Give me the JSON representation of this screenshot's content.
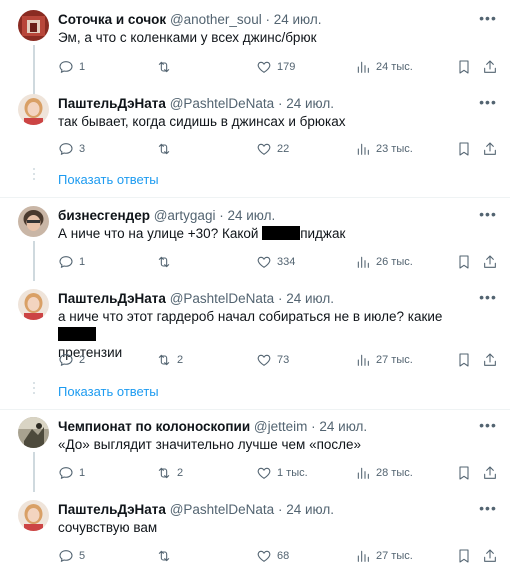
{
  "tweets": [
    {
      "name": "Соточка и сочок",
      "handle": "@another_soul",
      "date": "24 июл.",
      "text": "Эм, а что с коленками у всех джинс/брюк",
      "replies": "1",
      "retweets": "",
      "likes": "179",
      "views": "24 тыс."
    },
    {
      "name": "ПаштельДэНата",
      "handle": "@PashtelDeNata",
      "date": "24 июл.",
      "text": "так бывает, когда сидишь в джинсах и брюках",
      "replies": "3",
      "retweets": "",
      "likes": "22",
      "views": "23 тыс."
    },
    {
      "name": "бизнесгендер",
      "handle": "@artygagi",
      "date": "24 июл.",
      "text_a": "А ниче что на улице +30? Какой",
      "text_b": "пиджак",
      "replies": "1",
      "retweets": "",
      "likes": "334",
      "views": "26 тыс."
    },
    {
      "name": "ПаштельДэНата",
      "handle": "@PashtelDeNata",
      "date": "24 июл.",
      "text_a": "а ниче что этот гардероб начал собираться не в июле? какие",
      "text_b": "претензии",
      "replies": "2",
      "retweets": "2",
      "likes": "73",
      "views": "27 тыс."
    },
    {
      "name": "Чемпионат по колоноскопии",
      "handle": "@jetteim",
      "date": "24 июл.",
      "text": "«До» выглядит значительно лучше чем «после»",
      "replies": "1",
      "retweets": "2",
      "likes": "1 тыс.",
      "views": "28 тыс."
    },
    {
      "name": "ПаштельДэНата",
      "handle": "@PashtelDeNata",
      "date": "24 июл.",
      "text": "сочувствую вам",
      "replies": "5",
      "retweets": "",
      "likes": "68",
      "views": "27 тыс."
    }
  ],
  "show_replies": "Показать ответы",
  "separator_dot": "·",
  "colors": {
    "accent": "#1d9bf0",
    "secondary_text": "#536471",
    "thread_line": "#cfd9de"
  },
  "icons": [
    "reply-icon",
    "retweet-icon",
    "like-icon",
    "views-icon",
    "bookmark-icon",
    "share-icon",
    "more-icon"
  ]
}
